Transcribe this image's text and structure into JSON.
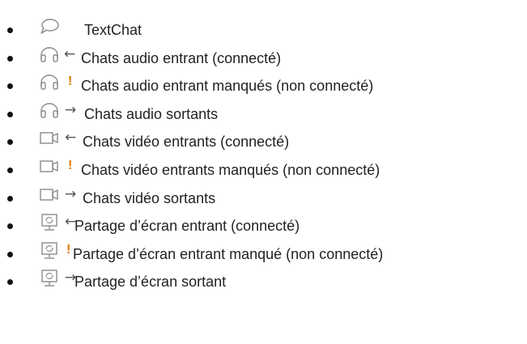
{
  "items": [
    {
      "label": "TextChat",
      "icon": "chat-bubble-icon",
      "direction": "",
      "direction_name": "none"
    },
    {
      "label": "Chats audio entrant (connecté)",
      "icon": "headphones-icon",
      "direction": "←",
      "direction_name": "arrow-left-icon"
    },
    {
      "label": "Chats audio entrant manqués (non connecté)",
      "icon": "headphones-icon",
      "direction": "!",
      "direction_name": "exclamation-icon"
    },
    {
      "label": "Chats audio sortants",
      "icon": "headphones-icon",
      "direction": "→",
      "direction_name": "arrow-right-icon"
    },
    {
      "label": "Chats vidéo entrants (connecté)",
      "icon": "video-camera-icon",
      "direction": "←",
      "direction_name": "arrow-left-icon"
    },
    {
      "label": "Chats vidéo entrants manqués (non connecté)",
      "icon": "video-camera-icon",
      "direction": "!",
      "direction_name": "exclamation-icon"
    },
    {
      "label": "Chats vidéo sortants",
      "icon": "video-camera-icon",
      "direction": "→",
      "direction_name": "arrow-right-icon"
    },
    {
      "label": "Partage d’écran entrant (connecté)",
      "icon": "screen-share-icon",
      "direction": "←",
      "direction_name": "arrow-left-icon"
    },
    {
      "label": "Partage d’écran entrant manqué (non connecté)",
      "icon": "screen-share-icon",
      "direction": "!",
      "direction_name": "exclamation-icon"
    },
    {
      "label": "Partage d’écran sortant",
      "icon": "screen-share-icon",
      "direction": "→",
      "direction_name": "arrow-right-icon"
    }
  ],
  "colors": {
    "icon_stroke": "#8a8a8a",
    "warning": "#e07700",
    "text": "#222222"
  }
}
